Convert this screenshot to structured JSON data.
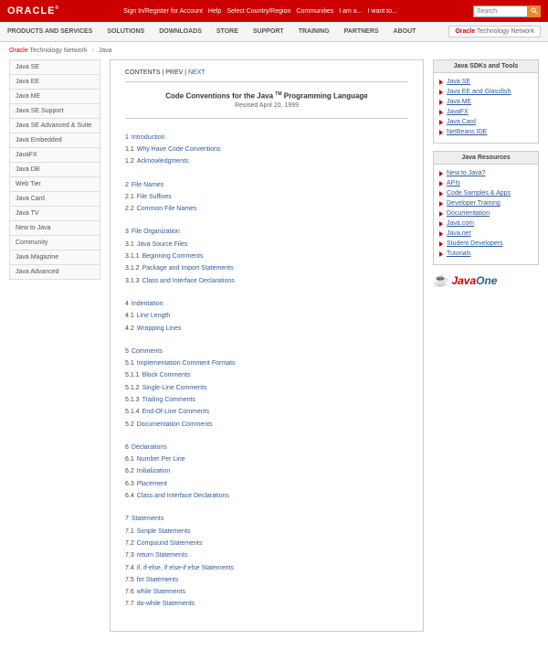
{
  "header": {
    "logo": "ORACLE",
    "links": [
      "Sign In/Register for Account",
      "Help",
      "Select Country/Region",
      "Communities",
      "I am a...",
      "I want to..."
    ],
    "search_placeholder": "Search"
  },
  "nav": {
    "items": [
      "PRODUCTS AND SERVICES",
      "SOLUTIONS",
      "DOWNLOADS",
      "STORE",
      "SUPPORT",
      "TRAINING",
      "PARTNERS",
      "ABOUT"
    ],
    "right_bold": "Oracle",
    "right_rest": " Technology Network"
  },
  "crumb": {
    "a": "Oracle",
    "b": "Technology Network",
    "cur": "Java",
    "sep": "›"
  },
  "left_nav": [
    "Java SE",
    "Java EE",
    "Java ME",
    "Java SE Support",
    "Java SE Advanced & Suite",
    "Java Embedded",
    "JavaFX",
    "Java DB",
    "Web Tier",
    "Java Card",
    "Java TV",
    "New to Java",
    "Community",
    "Java Magazine",
    "Java Advanced"
  ],
  "pager": {
    "contents": "CONTENTS",
    "prev": "PREV",
    "next": "NEXT",
    "sep": " | "
  },
  "doc": {
    "title_a": "Code Conventions for the Java ",
    "tm": "TM",
    "title_b": " Programming Language",
    "sub": "Revised April 20, 1999"
  },
  "toc": [
    {
      "n": "1",
      "t": "Introduction",
      "items": [
        {
          "n": "1.1",
          "t": "Why Have Code Conventions"
        },
        {
          "n": "1.2",
          "t": "Acknowledgments"
        }
      ]
    },
    {
      "n": "2",
      "t": "File Names",
      "items": [
        {
          "n": "2.1",
          "t": "File Suffixes"
        },
        {
          "n": "2.2",
          "t": "Common File Names"
        }
      ]
    },
    {
      "n": "3",
      "t": "File Organization",
      "items": [
        {
          "n": "3.1",
          "t": "Java Source Files"
        },
        {
          "n": "3.1.1",
          "t": "Beginning Comments"
        },
        {
          "n": "3.1.2",
          "t": "Package and Import Statements"
        },
        {
          "n": "3.1.3",
          "t": "Class and Interface Declarations"
        }
      ]
    },
    {
      "n": "4",
      "t": "Indentation",
      "items": [
        {
          "n": "4.1",
          "t": "Line Length"
        },
        {
          "n": "4.2",
          "t": "Wrapping Lines"
        }
      ]
    },
    {
      "n": "5",
      "t": "Comments",
      "items": [
        {
          "n": "5.1",
          "t": "Implementation Comment Formats"
        },
        {
          "n": "5.1.1",
          "t": "Block Comments"
        },
        {
          "n": "5.1.2",
          "t": "Single-Line Comments"
        },
        {
          "n": "5.1.3",
          "t": "Trailing Comments"
        },
        {
          "n": "5.1.4",
          "t": "End-Of-Line Comments"
        },
        {
          "n": "5.2",
          "t": "Documentation Comments"
        }
      ]
    },
    {
      "n": "6",
      "t": "Declarations",
      "items": [
        {
          "n": "6.1",
          "t": "Number Per Line"
        },
        {
          "n": "6.2",
          "t": "Initialization"
        },
        {
          "n": "6.3",
          "t": "Placement"
        },
        {
          "n": "6.4",
          "t": "Class and Interface Declarations"
        }
      ]
    },
    {
      "n": "7",
      "t": "Statements",
      "items": [
        {
          "n": "7.1",
          "t": "Simple Statements"
        },
        {
          "n": "7.2",
          "t": "Compound Statements"
        },
        {
          "n": "7.3",
          "t": "return Statements"
        },
        {
          "n": "7.4",
          "t": "if, if-else, if else-if else Statements"
        },
        {
          "n": "7.5",
          "t": "for Statements"
        },
        {
          "n": "7.6",
          "t": "while Statements"
        },
        {
          "n": "7.7",
          "t": "do-while Statements"
        }
      ]
    }
  ],
  "right": {
    "h1": "Java SDKs and Tools",
    "sdks": [
      "Java SE",
      "Java EE and Glassfish",
      "Java ME",
      "JavaFX",
      "Java Card",
      "NetBeans IDE"
    ],
    "h2": "Java Resources",
    "res": [
      "New to Java?",
      "APIs",
      "Code Samples & Apps",
      "Developer Training",
      "Documentation",
      "Java.com",
      "Java.net",
      "Student Developers",
      "Tutorials"
    ],
    "jo_a": "Java",
    "jo_b": "One"
  }
}
